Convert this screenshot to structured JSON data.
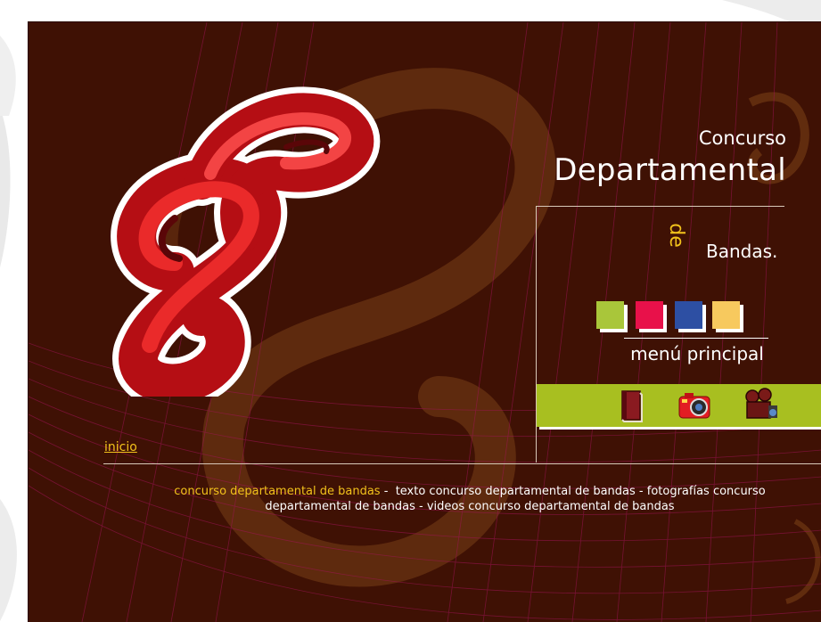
{
  "header": {
    "title_line1": "Concurso",
    "title_line2": "Departamental",
    "title_de": "de",
    "title_bandas": "Bandas."
  },
  "menu": {
    "label": "menú principal",
    "swatches": [
      {
        "name": "green",
        "color": "#a9c63a"
      },
      {
        "name": "red",
        "color": "#e8114a"
      },
      {
        "name": "blue",
        "color": "#2d4fa3"
      },
      {
        "name": "yellow",
        "color": "#f7c95e"
      }
    ],
    "icons": [
      "book-icon",
      "camera-icon",
      "video-camera-icon"
    ]
  },
  "nav": {
    "inicio": "inicio"
  },
  "footer": {
    "highlight": "concurso departamental de bandas",
    "sep1": " -  ",
    "link_texto": "texto concurso departamental de bandas",
    "sep2": " - ",
    "link_fotos": "fotografías concurso departamental de bandas",
    "sep3": " - ",
    "link_videos": "videos concurso departamental de bandas"
  },
  "colors": {
    "background": "#3f1104",
    "accent_yellow": "#f2c21b",
    "bar_green": "#a8bf20",
    "logo_red": "#e0161c"
  }
}
